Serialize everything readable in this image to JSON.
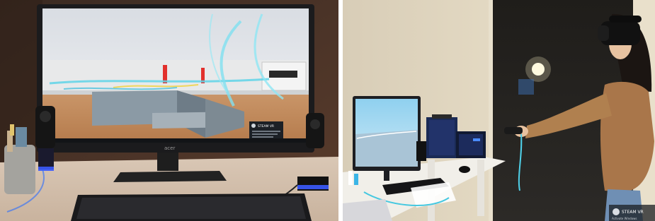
{
  "left_photo": {
    "monitor_brand": "acer",
    "popup_title": "STEAM VR"
  },
  "right_photo": {
    "steamvr_logo": "STEAM VR",
    "watermark_line": "Activate Windows"
  }
}
